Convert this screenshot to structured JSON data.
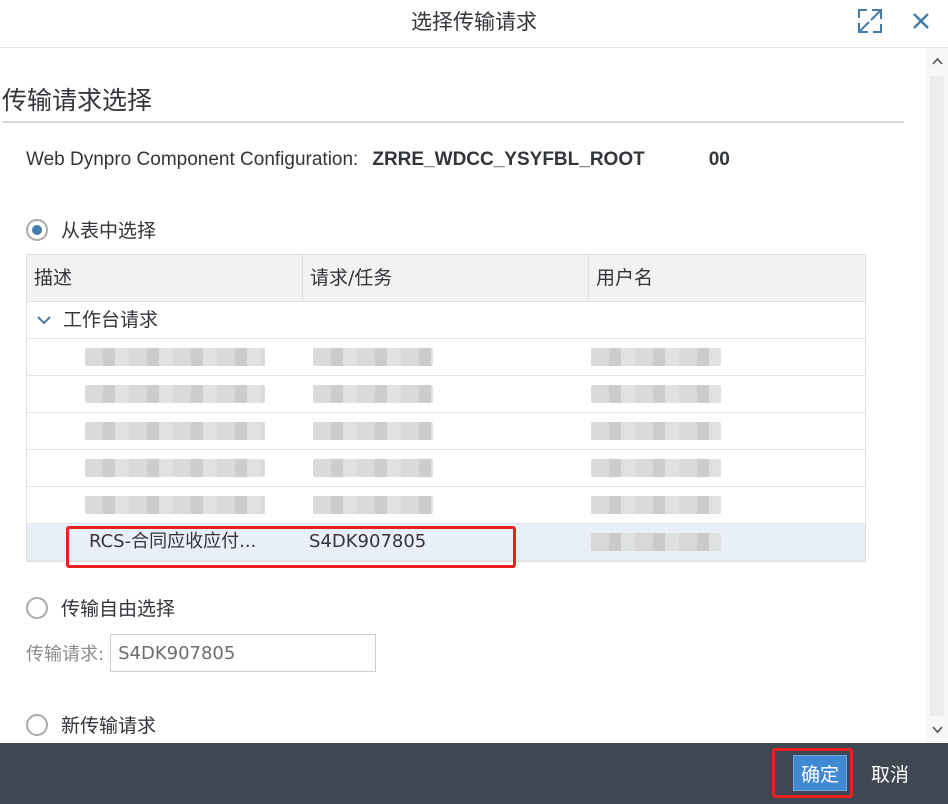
{
  "dialog": {
    "title": "选择传输请求",
    "expand_icon": "expand-icon",
    "close_icon": "close-icon"
  },
  "section": {
    "title": "传输请求选择"
  },
  "config": {
    "label": "Web Dynpro Component Configuration:",
    "value": "ZRRE_WDCC_YSYFBL_ROOT",
    "number": "00"
  },
  "options": {
    "from_list": "从表中选择",
    "free_select": "传输自由选择",
    "new_request": "新传输请求"
  },
  "table": {
    "headers": [
      "描述",
      "请求/任务",
      "用户名"
    ],
    "group_label": "工作台请求",
    "selected_row": {
      "description": "RCS-合同应收应付...",
      "request": "S4DK907805"
    }
  },
  "free_field": {
    "label": "传输请求:",
    "value": "S4DK907805"
  },
  "footer": {
    "ok_label": "确定",
    "cancel_label": "取消"
  },
  "colors": {
    "accent": "#427cac",
    "highlight": "#e8201e",
    "footer_bg": "#3f4752",
    "primary_button": "#3f8ad2"
  }
}
